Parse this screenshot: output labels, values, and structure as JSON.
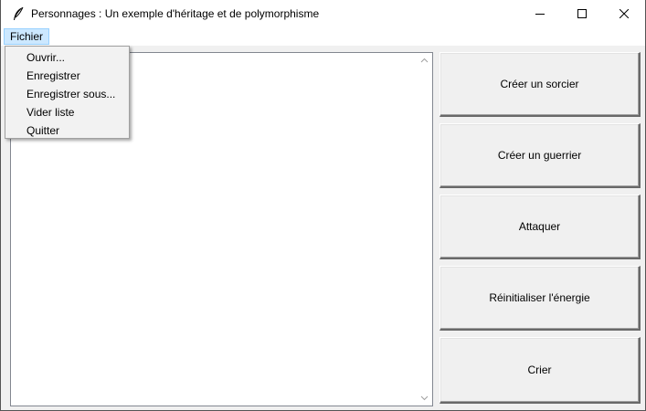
{
  "window": {
    "title": "Personnages : Un exemple d'héritage et de polymorphisme",
    "icon": "feather-icon"
  },
  "menubar": {
    "items": [
      {
        "label": "Fichier",
        "open": true
      }
    ]
  },
  "file_menu": {
    "items": [
      {
        "label": "Ouvrir..."
      },
      {
        "label": "Enregistrer"
      },
      {
        "label": "Enregistrer sous..."
      },
      {
        "label": "Vider liste"
      },
      {
        "label": "Quitter"
      }
    ]
  },
  "listbox": {
    "items": []
  },
  "buttons": [
    {
      "label": "Créer un sorcier"
    },
    {
      "label": "Créer un guerrier"
    },
    {
      "label": "Attaquer"
    },
    {
      "label": "Réinitialiser l'énergie"
    },
    {
      "label": "Crier"
    }
  ],
  "colors": {
    "menu_highlight": "#cce8ff",
    "menu_highlight_border": "#99d1ff",
    "window_bg": "#f0f0f0"
  }
}
